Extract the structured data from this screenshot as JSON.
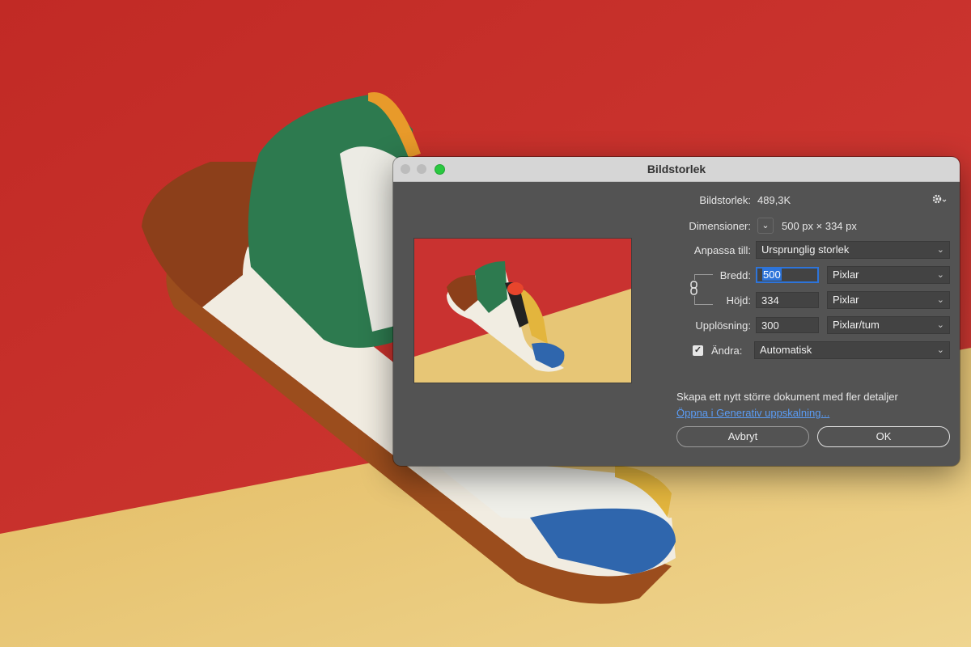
{
  "dialog": {
    "title": "Bildstorlek",
    "size_label": "Bildstorlek:",
    "size_value": "489,3K",
    "dimensions_label": "Dimensioner:",
    "dimensions_value": "500 px  ×  334 px",
    "fit_label": "Anpassa till:",
    "fit_value": "Ursprunglig storlek",
    "width_label": "Bredd:",
    "width_value": "500",
    "width_unit": "Pixlar",
    "height_label": "Höjd:",
    "height_value": "334",
    "height_unit": "Pixlar",
    "resolution_label": "Upplösning:",
    "resolution_value": "300",
    "resolution_unit": "Pixlar/tum",
    "resample_label": "Ändra:",
    "resample_checked": true,
    "resample_value": "Automatisk",
    "generative_hint": "Skapa ett nytt större dokument med fler detaljer",
    "generative_link": "Öppna i Generativ uppskalning...",
    "cancel_label": "Avbryt",
    "ok_label": "OK"
  },
  "icons": {
    "settings": "gear-icon",
    "link": "chain-link-icon",
    "dropdown": "chevron-down-icon",
    "checkbox": "checkmark-icon"
  },
  "colors": {
    "background_red": "#c9302c",
    "background_yellow": "#e8c873",
    "dialog_bg": "#535353",
    "accent_blue": "#2d74da",
    "link_blue": "#5a9cf5"
  }
}
